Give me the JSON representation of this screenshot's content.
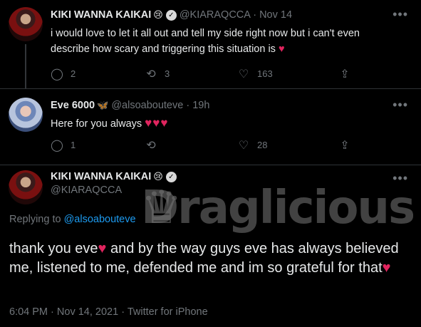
{
  "tweet1": {
    "name": "KIKI WANNA KAIKAI",
    "handle": "@KIARAQCCA",
    "sep": "·",
    "date": "Nov 14",
    "line1": "i would love to let it all out and tell my side right now but i can't even",
    "line2": "describe how scary and triggering this situation is",
    "heart": "♥",
    "replies": "2",
    "retweets": "3",
    "likes": "163"
  },
  "tweet2": {
    "name": "Eve 6000",
    "handle": "@alsoabouteve",
    "sep": "·",
    "date": "19h",
    "text": "Here for you always",
    "hearts": "♥♥♥",
    "replies": "1",
    "retweets": "",
    "likes": "28"
  },
  "main_tweet": {
    "name": "KIKI WANNA KAIKAI",
    "handle": "@KIARAQCCA",
    "replying_prefix": "Replying to",
    "replying_handle": "@alsoabouteve",
    "text_part1": "thank you eve",
    "text_part2": " and by the way guys eve has always believed me, listened to me, defended me and im so grateful for that",
    "heart": "♥",
    "time": "6:04 PM",
    "date": "Nov 14, 2021",
    "source": "Twitter for iPhone",
    "sep": "·"
  },
  "watermark": {
    "text": "Draglicious"
  },
  "icons": {
    "reply": "reply-icon",
    "retweet": "retweet-icon",
    "like": "heart-icon",
    "share": "share-icon",
    "more": "more-icon",
    "verified": "verified-icon"
  },
  "colors": {
    "background": "#000000",
    "text": "#e7e9ea",
    "muted": "#71767b",
    "link": "#1d9bf0",
    "heart": "#e0245e",
    "divider": "#2f3336"
  }
}
